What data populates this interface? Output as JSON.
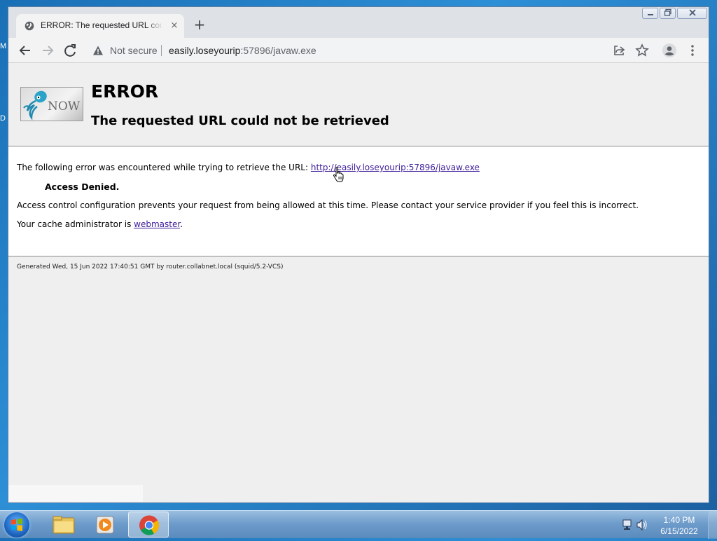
{
  "desktop": {
    "frag_top": "M",
    "frag_mid": "D"
  },
  "browser": {
    "tab": {
      "title": "ERROR: The requested URL could not be retrieved",
      "close": "×"
    },
    "new_tab": "+",
    "omnibox": {
      "security_label": "Not secure",
      "url_host": "easily.loseyourip",
      "url_rest": ":57896/javaw.exe"
    }
  },
  "page": {
    "logo_text": "NOW",
    "heading": "ERROR",
    "subheading": "The requested URL could not be retrieved",
    "intro": "The following error was encountered while trying to retrieve the URL: ",
    "url_link": "http://easily.loseyourip:57896/javaw.exe",
    "error_title": "Access Denied.",
    "description": "Access control configuration prevents your request from being allowed at this time. Please contact your service provider if you feel this is incorrect.",
    "admin_prefix": "Your cache administrator is ",
    "admin_link": "webmaster",
    "admin_suffix": ".",
    "footer": "Generated Wed, 15 Jun 2022 17:40:51 GMT by router.collabnet.local (squid/5.2-VCS)"
  },
  "taskbar": {
    "apps": [
      "windows-explorer",
      "media-player",
      "chrome"
    ],
    "clock_time": "1:40 PM",
    "clock_date": "6/15/2022"
  },
  "colors": {
    "link": "#3d1c9a",
    "tabstrip": "#dee1e6",
    "page_bg": "#efefef"
  }
}
